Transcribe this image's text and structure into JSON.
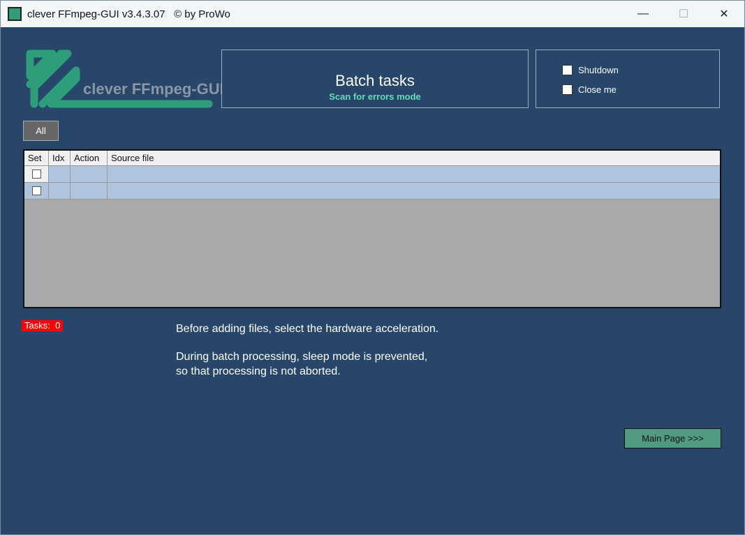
{
  "window": {
    "title": "clever FFmpeg-GUI v3.4.3.07   © by ProWo",
    "minimize": "—",
    "maximize": "☐",
    "close": "✕"
  },
  "logo": {
    "text": "clever FFmpeg-GUI",
    "color": "#2e9d7a"
  },
  "batch": {
    "title": "Batch tasks",
    "subtitle": "Scan for errors mode"
  },
  "options": {
    "shutdown": "Shutdown",
    "close_me": "Close me",
    "shutdown_checked": false,
    "close_me_checked": false
  },
  "all_button": "All",
  "table": {
    "columns": [
      "Set",
      "Idx",
      "Action",
      "Source file"
    ],
    "rows": [
      {
        "set": false,
        "idx": "",
        "action": "",
        "source": ""
      },
      {
        "set": false,
        "idx": "",
        "action": "",
        "source": ""
      }
    ]
  },
  "tasks": "Tasks:  0",
  "info": {
    "line1": "Before adding files, select the hardware acceleration.",
    "line2": "During batch processing, sleep mode is prevented,",
    "line3": "so that processing is not aborted."
  },
  "main_page_button": "Main Page >>>"
}
